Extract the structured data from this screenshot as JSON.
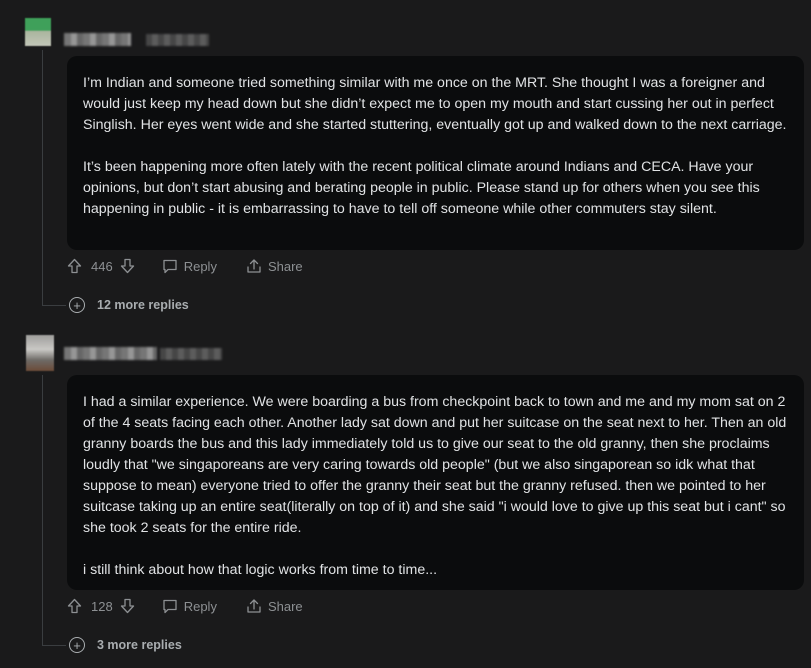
{
  "comments": [
    {
      "paragraphs": [
        "I’m Indian and someone tried something similar with me once on the MRT. She thought I was a foreigner and would just keep my head down but she didn’t expect me to open my mouth and start cussing her out in perfect Singlish. Her eyes went wide and she started stuttering, eventually got up and walked down to the next carriage.",
        "It’s been happening more often lately with the recent political climate around Indians and CECA. Have your opinions, but don’t start abusing and berating people in public. Please stand up for others when you see this happening in public - it is embarrassing to have to tell off someone while other commuters stay silent."
      ],
      "votes": "446",
      "reply_label": "Reply",
      "share_label": "Share",
      "more_replies": "12 more replies"
    },
    {
      "paragraphs": [
        "I had a similar experience. We were boarding a bus from checkpoint back to town and me and my mom sat on 2 of the 4 seats facing each other. Another lady sat down and put her suitcase on the seat next to her. Then an old granny boards the bus and this lady immediately told us to give our seat to the old granny, then she proclaims loudly that \"we singaporeans are very caring towards old people\" (but we also singaporean so idk what that suppose to mean) everyone tried to offer the granny their seat but the granny refused. then we pointed to her suitcase taking up an entire seat(literally on top of it) and she said \"i would love to give up this seat but i cant\" so she took 2 seats for the entire ride.",
        "i still think about how that logic works from time to time..."
      ],
      "votes": "128",
      "reply_label": "Reply",
      "share_label": "Share",
      "more_replies": "3 more replies"
    }
  ],
  "icons": {
    "upvote": "upvote-arrow-icon",
    "downvote": "downvote-arrow-icon",
    "reply": "speech-bubble-icon",
    "share": "share-icon",
    "expand": "plus-circle-icon"
  },
  "colors": {
    "background": "#1a1a1b",
    "bubble": "#0b0c0d",
    "text": "#e1e3e5",
    "muted": "#8d9093"
  }
}
